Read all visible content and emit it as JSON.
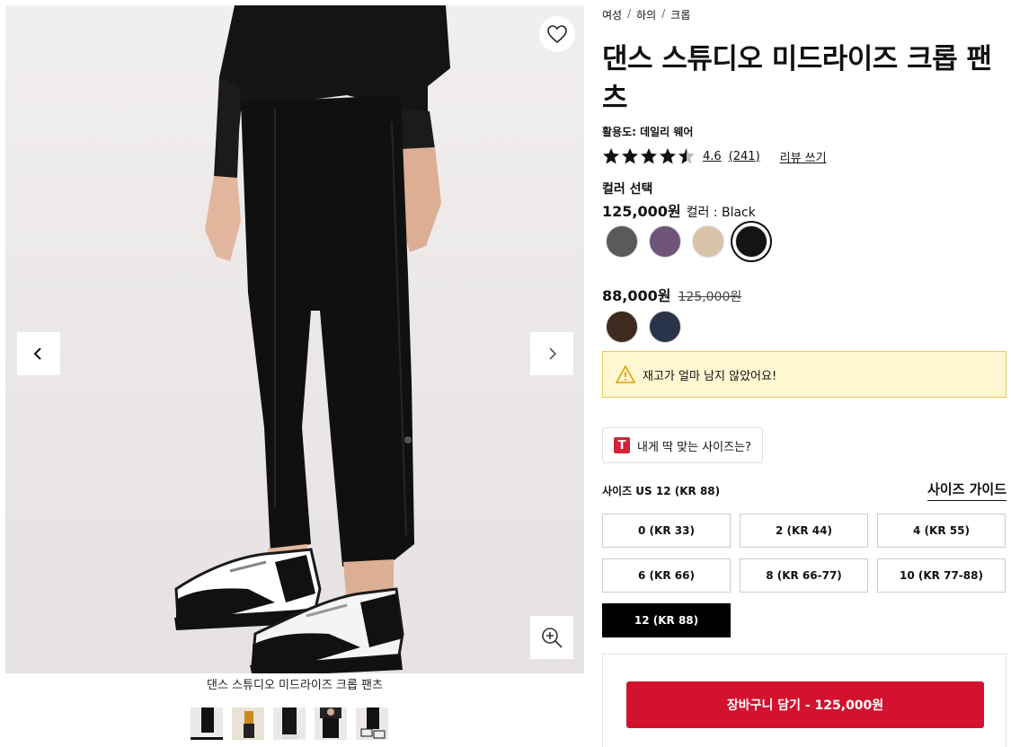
{
  "gallery": {
    "caption": "댄스 스튜디오 미드라이즈 크롭 팬츠",
    "thumb_count": 5,
    "active_thumb": 0
  },
  "product": {
    "breadcrumb": [
      "여성",
      "하의",
      "크롭"
    ],
    "title": "댄스 스튜디오 미드라이즈 크롭 팬츠",
    "usage": "활용도: 데일리 웨어",
    "rating": {
      "stars": 4.5,
      "score": "4.6",
      "count": "(241)"
    },
    "review_link": "리뷰 쓰기",
    "color_section_label": "컬러 선택",
    "price": "125,000원",
    "color_name": "컬러 : Black",
    "swatches": [
      {
        "color": "#5a5a5a",
        "selected": false
      },
      {
        "color": "#6e5479",
        "selected": false
      },
      {
        "color": "#d8c4a8",
        "selected": false
      },
      {
        "color": "#141414",
        "selected": true
      }
    ],
    "sale_price": "88,000원",
    "original_price": "125,000원",
    "sale_swatches": [
      {
        "color": "#3e2a1f",
        "selected": false
      },
      {
        "color": "#2a3448",
        "selected": false
      }
    ],
    "stock_alert": "재고가 얼마 남지 않았어요!",
    "fit_button": {
      "logo": "T",
      "label": "내게 딱 맞는 사이즈는?"
    },
    "size_label": "사이즈 US 12 (KR 88)",
    "size_guide": "사이즈 가이드",
    "sizes": [
      {
        "label": "0 (KR 33)",
        "selected": false
      },
      {
        "label": "2 (KR 44)",
        "selected": false
      },
      {
        "label": "4 (KR 55)",
        "selected": false
      },
      {
        "label": "6 (KR 66)",
        "selected": false
      },
      {
        "label": "8 (KR 66-77)",
        "selected": false
      },
      {
        "label": "10 (KR 77-88)",
        "selected": false
      },
      {
        "label": "12 (KR 88)",
        "selected": true
      }
    ],
    "add_to_cart": "장바구니 담기 - 125,000원"
  },
  "colors": {
    "accent": "#d2122e",
    "alert_bg": "#fff7d1",
    "alert_border": "#e8c85a"
  },
  "icons": [
    "heart-icon",
    "chevron-left-icon",
    "chevron-right-icon",
    "zoom-in-icon",
    "warning-icon",
    "star-icon"
  ]
}
